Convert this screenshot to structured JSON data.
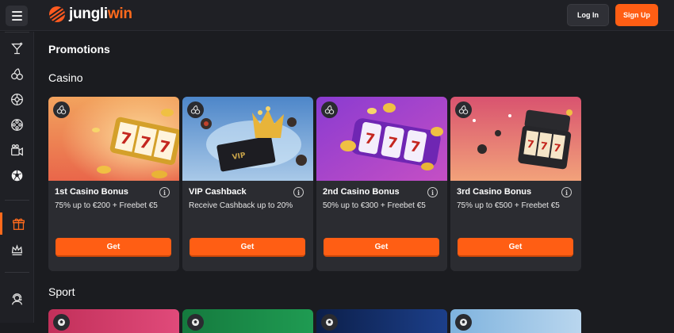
{
  "header": {
    "logo_left": "jungli",
    "logo_right": "win",
    "login_label": "Log In",
    "signup_label": "Sign Up"
  },
  "sidebar": {
    "items": [
      {
        "icon": "cocktail-icon"
      },
      {
        "icon": "cherries-icon"
      },
      {
        "icon": "roulette-icon"
      },
      {
        "icon": "film-reel-icon"
      },
      {
        "icon": "live-casino-icon"
      },
      {
        "icon": "soccer-ball-icon"
      },
      {
        "icon": "gift-icon",
        "active": true
      },
      {
        "icon": "crown-icon"
      },
      {
        "icon": "support-agent-icon"
      }
    ]
  },
  "main": {
    "page_title": "Promotions",
    "casino_section": "Casino",
    "sport_section": "Sport",
    "casino_cards": [
      {
        "title": "1st Casino Bonus",
        "subtitle": "75% up to €200 + Freebet €5",
        "button": "Get",
        "info": "i",
        "image": "slot-machine-777-warm"
      },
      {
        "title": "VIP Cashback",
        "subtitle": "Receive Cashback up to 20%",
        "button": "Get",
        "info": "i",
        "image": "vip-crown-card"
      },
      {
        "title": "2nd Casino Bonus",
        "subtitle": "50% up to €300 + Freebet €5",
        "button": "Get",
        "info": "i",
        "image": "purple-slot-reels"
      },
      {
        "title": "3rd Casino Bonus",
        "subtitle": "75% up to €500 + Freebet €5",
        "button": "Get",
        "info": "i",
        "image": "pink-slot-machine"
      }
    ]
  },
  "colors": {
    "accent": "#ff5e14",
    "background": "#1b1c20",
    "card": "#2b2c31"
  }
}
